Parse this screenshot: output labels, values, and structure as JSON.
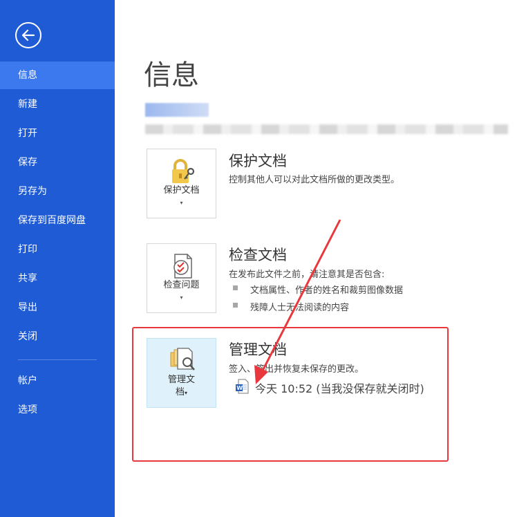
{
  "sidebar": {
    "items": [
      {
        "label": "信息"
      },
      {
        "label": "新建"
      },
      {
        "label": "打开"
      },
      {
        "label": "保存"
      },
      {
        "label": "另存为"
      },
      {
        "label": "保存到百度网盘"
      },
      {
        "label": "打印"
      },
      {
        "label": "共享"
      },
      {
        "label": "导出"
      },
      {
        "label": "关闭"
      },
      {
        "label": "帐户"
      },
      {
        "label": "选项"
      }
    ],
    "active_index": 0,
    "accent": "#1f5bd4"
  },
  "main": {
    "title": "信息",
    "sections": [
      {
        "tile_label": "保护文档",
        "title": "保护文档",
        "desc": "控制其他人可以对此文档所做的更改类型。",
        "icon": "lock-key-icon"
      },
      {
        "tile_label": "检查问题",
        "title": "检查文档",
        "desc": "在发布此文件之前，请注意其是否包含:",
        "bullets": [
          "文档属性、作者的姓名和裁剪图像数据",
          "残障人士无法阅读的内容"
        ],
        "icon": "inspect-document-icon"
      },
      {
        "tile_label_line1": "管理文",
        "tile_label_line2": "档",
        "title": "管理文档",
        "desc": "签入、签出并恢复未保存的更改。",
        "version": "今天 10:52 (当我没保存就关闭时)",
        "icon": "manage-document-icon"
      }
    ]
  },
  "annotation": {
    "color": "#e8383d"
  }
}
